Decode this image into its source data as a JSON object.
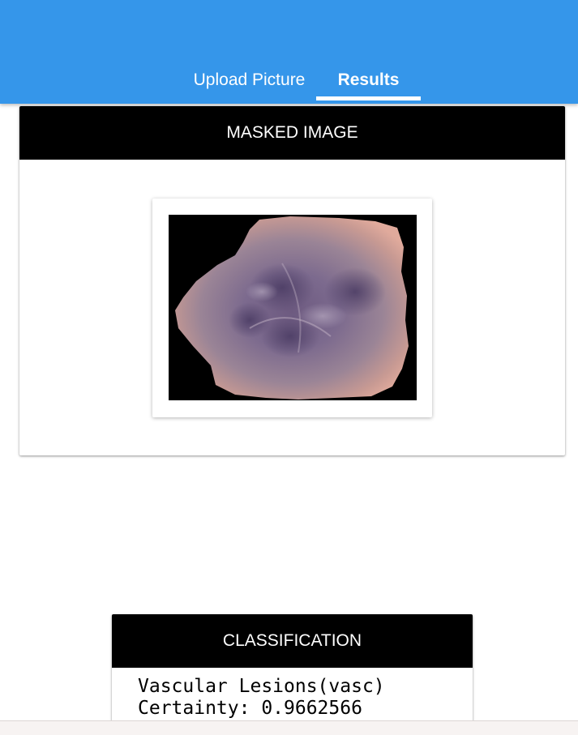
{
  "tabs": [
    {
      "label": "Upload Picture",
      "active": false
    },
    {
      "label": "Results",
      "active": true
    }
  ],
  "masked": {
    "header": "MASKED IMAGE",
    "image_icon": "skin-lesion-image"
  },
  "classification": {
    "header": "CLASSIFICATION",
    "result": "Vascular Lesions(vasc)",
    "certainty": "Certainty: 0.9662566"
  },
  "colors": {
    "appbar": "#3596ea",
    "card_header": "#000000",
    "tab_text": "#ffffff"
  }
}
